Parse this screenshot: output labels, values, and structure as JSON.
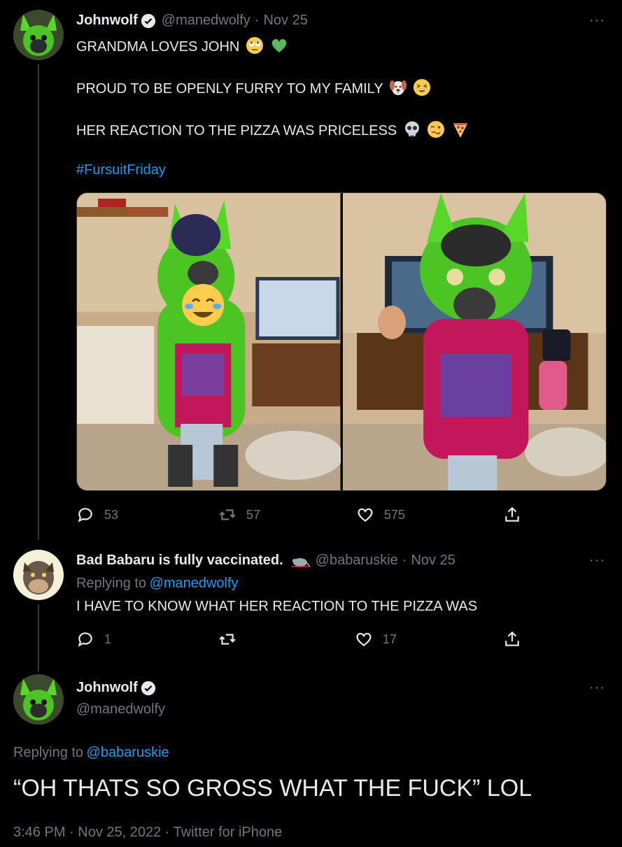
{
  "tweet1": {
    "display_name": "Johnwolf",
    "handle": "@manedwolfy",
    "separator": "·",
    "date": "Nov 25",
    "more": "···",
    "line1": "GRANDMA LOVES JOHN",
    "line2": "PROUD TO BE OPENLY FURRY TO MY FAMILY",
    "line3": "HER REACTION TO THE PIZZA WAS PRICELESS",
    "hashtag": "#FursuitFriday",
    "line1_emojis": [
      "face-with-rolling-eyes-emoji",
      "green-heart-emoji"
    ],
    "line2_emojis": [
      "dog-face-emoji",
      "grinning-squinting-face-emoji"
    ],
    "line3_emojis": [
      "skull-emoji",
      "woozy-face-emoji",
      "pizza-emoji"
    ],
    "photos": [
      "fursuit-photo-with-grandma",
      "fursuit-photo-waving"
    ],
    "replies": "53",
    "retweets": "57",
    "likes": "575"
  },
  "tweet2": {
    "display_name": "Bad Babaru is fully vaccinated.",
    "handle": "@babaruskie",
    "separator": "·",
    "date": "Nov 25",
    "more": "···",
    "replying_prefix": "Replying to",
    "replying_to": "@manedwolfy",
    "text": "I HAVE TO KNOW WHAT HER REACTION TO THE PIZZA WAS",
    "replies": "1",
    "retweets": "",
    "likes": "17"
  },
  "tweet3": {
    "display_name": "Johnwolf",
    "handle": "@manedwolfy",
    "more": "···",
    "replying_prefix": "Replying to",
    "replying_to": "@babaruskie",
    "text": "“OH THATS SO GROSS WHAT THE FUCK” LOL",
    "timestamp": "3:46 PM · Nov 25, 2022 · Twitter for iPhone"
  },
  "colors": {
    "background": "#000000",
    "text": "#e7e9ea",
    "muted": "#71767b",
    "link": "#1d9bf0",
    "verified": "#1d9bf0"
  }
}
